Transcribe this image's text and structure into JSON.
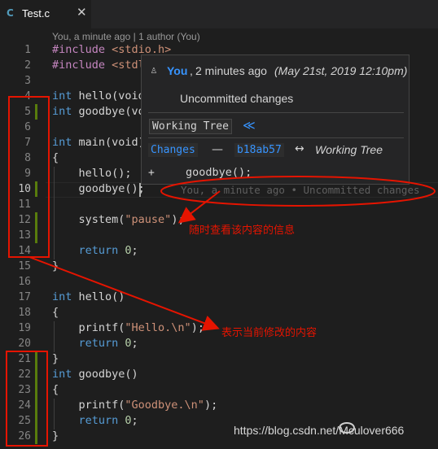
{
  "tab": {
    "icon_glyph": "C",
    "icon_name": "c-language-icon",
    "filename": "Test.c",
    "close_glyph": "✕"
  },
  "codelens": "You, a minute ago | 1 author (You)",
  "lines": [
    {
      "n": "1"
    },
    {
      "n": "2"
    },
    {
      "n": "3"
    },
    {
      "n": "4"
    },
    {
      "n": "5"
    },
    {
      "n": "6"
    },
    {
      "n": "7"
    },
    {
      "n": "8"
    },
    {
      "n": "9"
    },
    {
      "n": "10"
    },
    {
      "n": "11"
    },
    {
      "n": "12"
    },
    {
      "n": "13"
    },
    {
      "n": "14"
    },
    {
      "n": "15"
    },
    {
      "n": "16"
    },
    {
      "n": "17"
    },
    {
      "n": "18"
    },
    {
      "n": "19"
    },
    {
      "n": "20"
    },
    {
      "n": "21"
    },
    {
      "n": "22"
    },
    {
      "n": "23"
    },
    {
      "n": "24"
    },
    {
      "n": "25"
    },
    {
      "n": "26"
    }
  ],
  "code": {
    "l1": {
      "kw": "#include",
      "rest": " <stdio.h>"
    },
    "l2": {
      "kw": "#include",
      "rest": " <stdl"
    },
    "l4": {
      "kw": "int",
      "rest": " hello(void"
    },
    "l5": {
      "kw": "int",
      "rest": " goodbye(vo"
    },
    "l7": {
      "kw": "int",
      "rest": " main(void)"
    },
    "l8": {
      "text": "{"
    },
    "l9": {
      "text": "    hello();"
    },
    "l10": {
      "text": "    goodbye();"
    },
    "l12": {
      "pre": "    system(",
      "str": "\"pause\"",
      "post": ");"
    },
    "l14": {
      "kw": "    return",
      "num": " 0",
      "post": ";"
    },
    "l15": {
      "text": "}"
    },
    "l17": {
      "kw": "int",
      "rest": " hello()"
    },
    "l18": {
      "text": "{"
    },
    "l19": {
      "pre": "    printf(",
      "str": "\"Hello.\\n\"",
      "post": ");"
    },
    "l20": {
      "kw": "    return",
      "num": " 0",
      "post": ";"
    },
    "l21": {
      "text": "}"
    },
    "l22": {
      "kw": "int",
      "rest": " goodbye()"
    },
    "l23": {
      "text": "{"
    },
    "l24": {
      "pre": "    printf(",
      "str": "\"Goodbye.\\n\"",
      "post": ");"
    },
    "l25": {
      "kw": "    return",
      "num": " 0",
      "post": ";"
    },
    "l26": {
      "text": "}"
    }
  },
  "inline_blame": "You, a minute ago • Uncommitted changes",
  "hover": {
    "icon_name": "git-commit-icon",
    "icon_glyph": "♙",
    "author": "You",
    "comma": ",",
    "relative": "2 minutes ago",
    "date": "(May 21st, 2019 12:10pm)",
    "message": "Uncommitted changes",
    "working_tree_label": "Working Tree",
    "working_tree_button": "≪",
    "changes_label": "Changes",
    "dash": "—",
    "sha": "b18ab57",
    "arrow": "↔",
    "working_tree_italic": "Working Tree",
    "diff_sign": "+",
    "diff_text": "goodbye();"
  },
  "annotations": {
    "note_1": "随时查看该内容的信息",
    "note_2": "表示当前修改的内容",
    "color": "#e51400"
  },
  "watermark": "https://blog.csdn.net/Mculover666",
  "watermark_logo_text": "Mculover666",
  "colors": {
    "editor_bg": "#1e1e1e",
    "keyword": "#569cd6",
    "string": "#ce9178",
    "number": "#b5cea8",
    "gutter_added": "#587c0c",
    "link": "#3794ff"
  }
}
